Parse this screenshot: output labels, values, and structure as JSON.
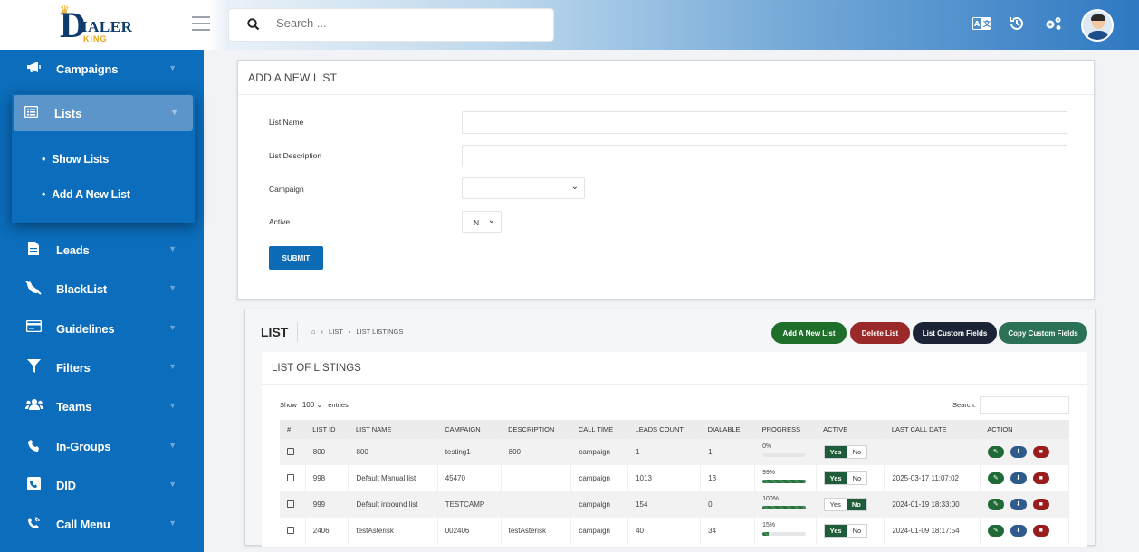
{
  "brand": {
    "main": "IALER",
    "sub": "KING"
  },
  "search": {
    "placeholder": "Search ..."
  },
  "sidebar": {
    "items": [
      {
        "label": "Campaigns",
        "icon": "megaphone-icon"
      },
      {
        "label": "Lists",
        "icon": "list-icon"
      },
      {
        "label": "Leads",
        "icon": "file-icon"
      },
      {
        "label": "BlackList",
        "icon": "phone-slash-icon"
      },
      {
        "label": "Guidelines",
        "icon": "card-icon"
      },
      {
        "label": "Filters",
        "icon": "filter-icon"
      },
      {
        "label": "Teams",
        "icon": "users-icon"
      },
      {
        "label": "In-Groups",
        "icon": "phone-icon"
      },
      {
        "label": "DID",
        "icon": "phone-square-icon"
      },
      {
        "label": "Call Menu",
        "icon": "phone-volume-icon"
      }
    ],
    "lists_sub": [
      "Show Lists",
      "Add A New List"
    ]
  },
  "form": {
    "title": "ADD A NEW LIST",
    "list_name_label": "List Name",
    "list_desc_label": "List Description",
    "campaign_label": "Campaign",
    "campaign_value": "",
    "active_label": "Active",
    "active_value": "N",
    "submit": "SUBMIT"
  },
  "listing": {
    "title": "LIST",
    "breadcrumb": [
      "LIST",
      "LIST LISTINGS"
    ],
    "buttons": {
      "add": "Add A New List",
      "delete": "Delete List",
      "custom": "List Custom Fields",
      "copy": "Copy Custom Fields"
    },
    "inner_title": "LIST OF LISTINGS",
    "show_label": "Show",
    "show_value": "100",
    "entries_label": "entries",
    "search_label": "Search:",
    "columns": [
      "#",
      "LIST ID",
      "LIST NAME",
      "CAMPAIGN",
      "DESCRIPTION",
      "CALL TIME",
      "LEADS COUNT",
      "DIALABLE",
      "PROGRESS",
      "ACTIVE",
      "LAST CALL DATE",
      "ACTION"
    ],
    "rows": [
      {
        "id": "800",
        "name": "800",
        "campaign": "testing1",
        "description": "800",
        "call_time": "campaign",
        "leads": "1",
        "dialable": "1",
        "progress": 0,
        "progress_label": "0%",
        "active": "Yes",
        "last_call": ""
      },
      {
        "id": "998",
        "name": "Default Manual list",
        "campaign": "45470",
        "description": "",
        "call_time": "campaign",
        "leads": "1013",
        "dialable": "13",
        "progress": 99,
        "progress_label": "99%",
        "active": "Yes",
        "last_call": "2025-03-17 11:07:02"
      },
      {
        "id": "999",
        "name": "Default inbound list",
        "campaign": "TESTCAMP",
        "description": "",
        "call_time": "campaign",
        "leads": "154",
        "dialable": "0",
        "progress": 100,
        "progress_label": "100%",
        "active": "No",
        "last_call": "2024-01-19 18:33:00"
      },
      {
        "id": "2406",
        "name": "testAsterisk",
        "campaign": "002406",
        "description": "testAsterisk",
        "call_time": "campaign",
        "leads": "40",
        "dialable": "34",
        "progress": 15,
        "progress_label": "15%",
        "active": "Yes",
        "last_call": "2024-01-09 18:17:54"
      }
    ],
    "toggle": {
      "yes": "Yes",
      "no": "No"
    }
  },
  "colors": {
    "sidebar": "#0b6dbb",
    "primary": "#0d6bb5",
    "success": "#1f6f2b",
    "danger": "#9a2a2a",
    "dark": "#1b2437",
    "teal": "#2b7155"
  }
}
